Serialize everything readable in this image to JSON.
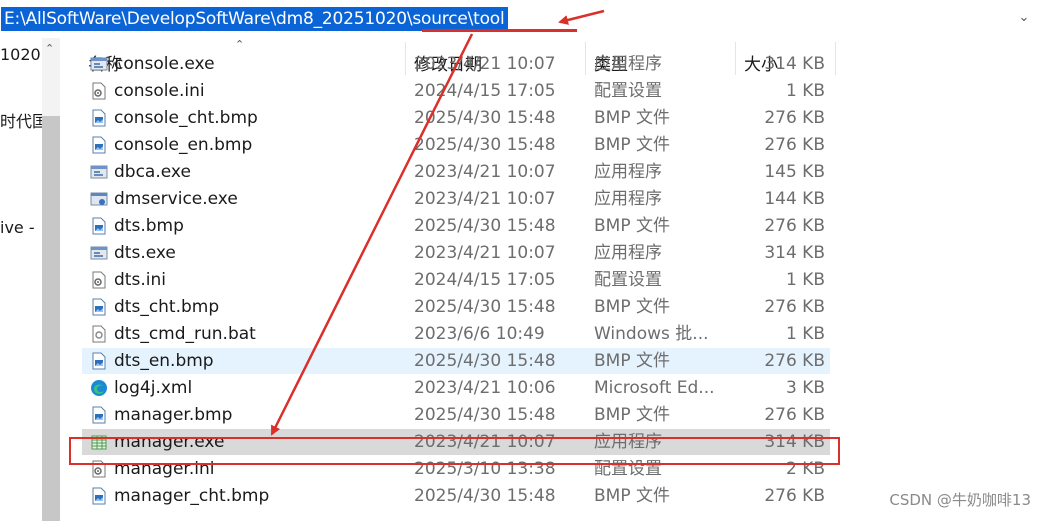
{
  "address_bar": {
    "path": "E:\\AllSoftWare\\DevelopSoftWare\\dm8_20251020\\source\\tool",
    "dropdown_icon": "chevron-down-icon"
  },
  "nav_pane": {
    "items": [
      {
        "label": "1020"
      },
      {
        "label": "时代国"
      },
      {
        "label": "ive -"
      }
    ]
  },
  "columns": {
    "name": "名称",
    "modified": "修改日期",
    "type": "类型",
    "size": "大小"
  },
  "files": [
    {
      "name": "console.exe",
      "modified": "2023/4/21 10:07",
      "type": "应用程序",
      "size": "314 KB",
      "icon": "exe-icon"
    },
    {
      "name": "console.ini",
      "modified": "2024/4/15 17:05",
      "type": "配置设置",
      "size": "1 KB",
      "icon": "settings-file-icon"
    },
    {
      "name": "console_cht.bmp",
      "modified": "2025/4/30 15:48",
      "type": "BMP 文件",
      "size": "276 KB",
      "icon": "image-file-icon"
    },
    {
      "name": "console_en.bmp",
      "modified": "2025/4/30 15:48",
      "type": "BMP 文件",
      "size": "276 KB",
      "icon": "image-file-icon"
    },
    {
      "name": "dbca.exe",
      "modified": "2023/4/21 10:07",
      "type": "应用程序",
      "size": "145 KB",
      "icon": "exe-icon"
    },
    {
      "name": "dmservice.exe",
      "modified": "2023/4/21 10:07",
      "type": "应用程序",
      "size": "144 KB",
      "icon": "service-exe-icon"
    },
    {
      "name": "dts.bmp",
      "modified": "2025/4/30 15:48",
      "type": "BMP 文件",
      "size": "276 KB",
      "icon": "image-file-icon"
    },
    {
      "name": "dts.exe",
      "modified": "2023/4/21 10:07",
      "type": "应用程序",
      "size": "314 KB",
      "icon": "exe-icon"
    },
    {
      "name": "dts.ini",
      "modified": "2024/4/15 17:05",
      "type": "配置设置",
      "size": "1 KB",
      "icon": "settings-file-icon"
    },
    {
      "name": "dts_cht.bmp",
      "modified": "2025/4/30 15:48",
      "type": "BMP 文件",
      "size": "276 KB",
      "icon": "image-file-icon"
    },
    {
      "name": "dts_cmd_run.bat",
      "modified": "2023/6/6 10:49",
      "type": "Windows 批...",
      "size": "1 KB",
      "icon": "batch-file-icon"
    },
    {
      "name": "dts_en.bmp",
      "modified": "2025/4/30 15:48",
      "type": "BMP 文件",
      "size": "276 KB",
      "icon": "image-file-icon",
      "state": "hover"
    },
    {
      "name": "log4j.xml",
      "modified": "2023/4/21 10:06",
      "type": "Microsoft Ed...",
      "size": "3 KB",
      "icon": "edge-icon"
    },
    {
      "name": "manager.bmp",
      "modified": "2025/4/30 15:48",
      "type": "BMP 文件",
      "size": "276 KB",
      "icon": "image-file-icon"
    },
    {
      "name": "manager.exe",
      "modified": "2023/4/21 10:07",
      "type": "应用程序",
      "size": "314 KB",
      "icon": "table-exe-icon",
      "state": "selected"
    },
    {
      "name": "manager.ini",
      "modified": "2025/3/10 13:38",
      "type": "配置设置",
      "size": "2 KB",
      "icon": "settings-file-icon"
    },
    {
      "name": "manager_cht.bmp",
      "modified": "2025/4/30 15:48",
      "type": "BMP 文件",
      "size": "276 KB",
      "icon": "image-file-icon"
    }
  ],
  "annotations": {
    "color": "#d9302b"
  },
  "watermark": "CSDN @牛奶咖啡13",
  "colors": {
    "address_selection": "#0a64d6",
    "hover_row": "#e5f3ff",
    "selected_row": "#d9d9d9",
    "secondary_text": "#6d6d6d"
  }
}
